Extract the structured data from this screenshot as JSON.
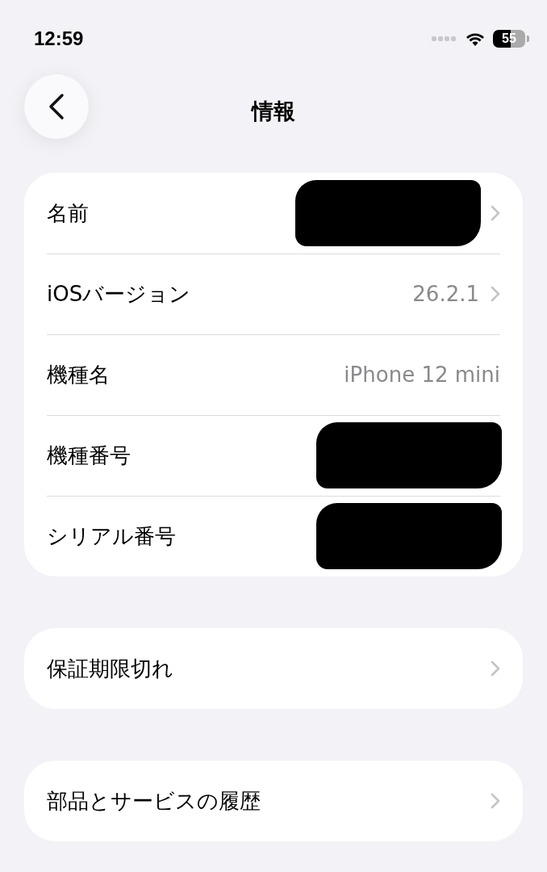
{
  "status_bar": {
    "time": "12:59",
    "battery": "55"
  },
  "nav": {
    "title": "情報"
  },
  "groups": [
    {
      "rows": [
        {
          "label": "名前",
          "redacted": true,
          "chevron": true
        },
        {
          "label": "iOSバージョン",
          "value": "26.2.1",
          "redacted": false,
          "chevron": true
        },
        {
          "label": "機種名",
          "value": "iPhone 12 mini",
          "redacted": false,
          "chevron": false
        },
        {
          "label": "機種番号",
          "redacted": true,
          "chevron": false
        },
        {
          "label": "シリアル番号",
          "redacted": true,
          "chevron": false
        }
      ]
    },
    {
      "rows": [
        {
          "label": "保証期限切れ",
          "redacted": false,
          "chevron": true
        }
      ]
    },
    {
      "rows": [
        {
          "label": "部品とサービスの履歴",
          "redacted": false,
          "chevron": true
        }
      ]
    }
  ]
}
